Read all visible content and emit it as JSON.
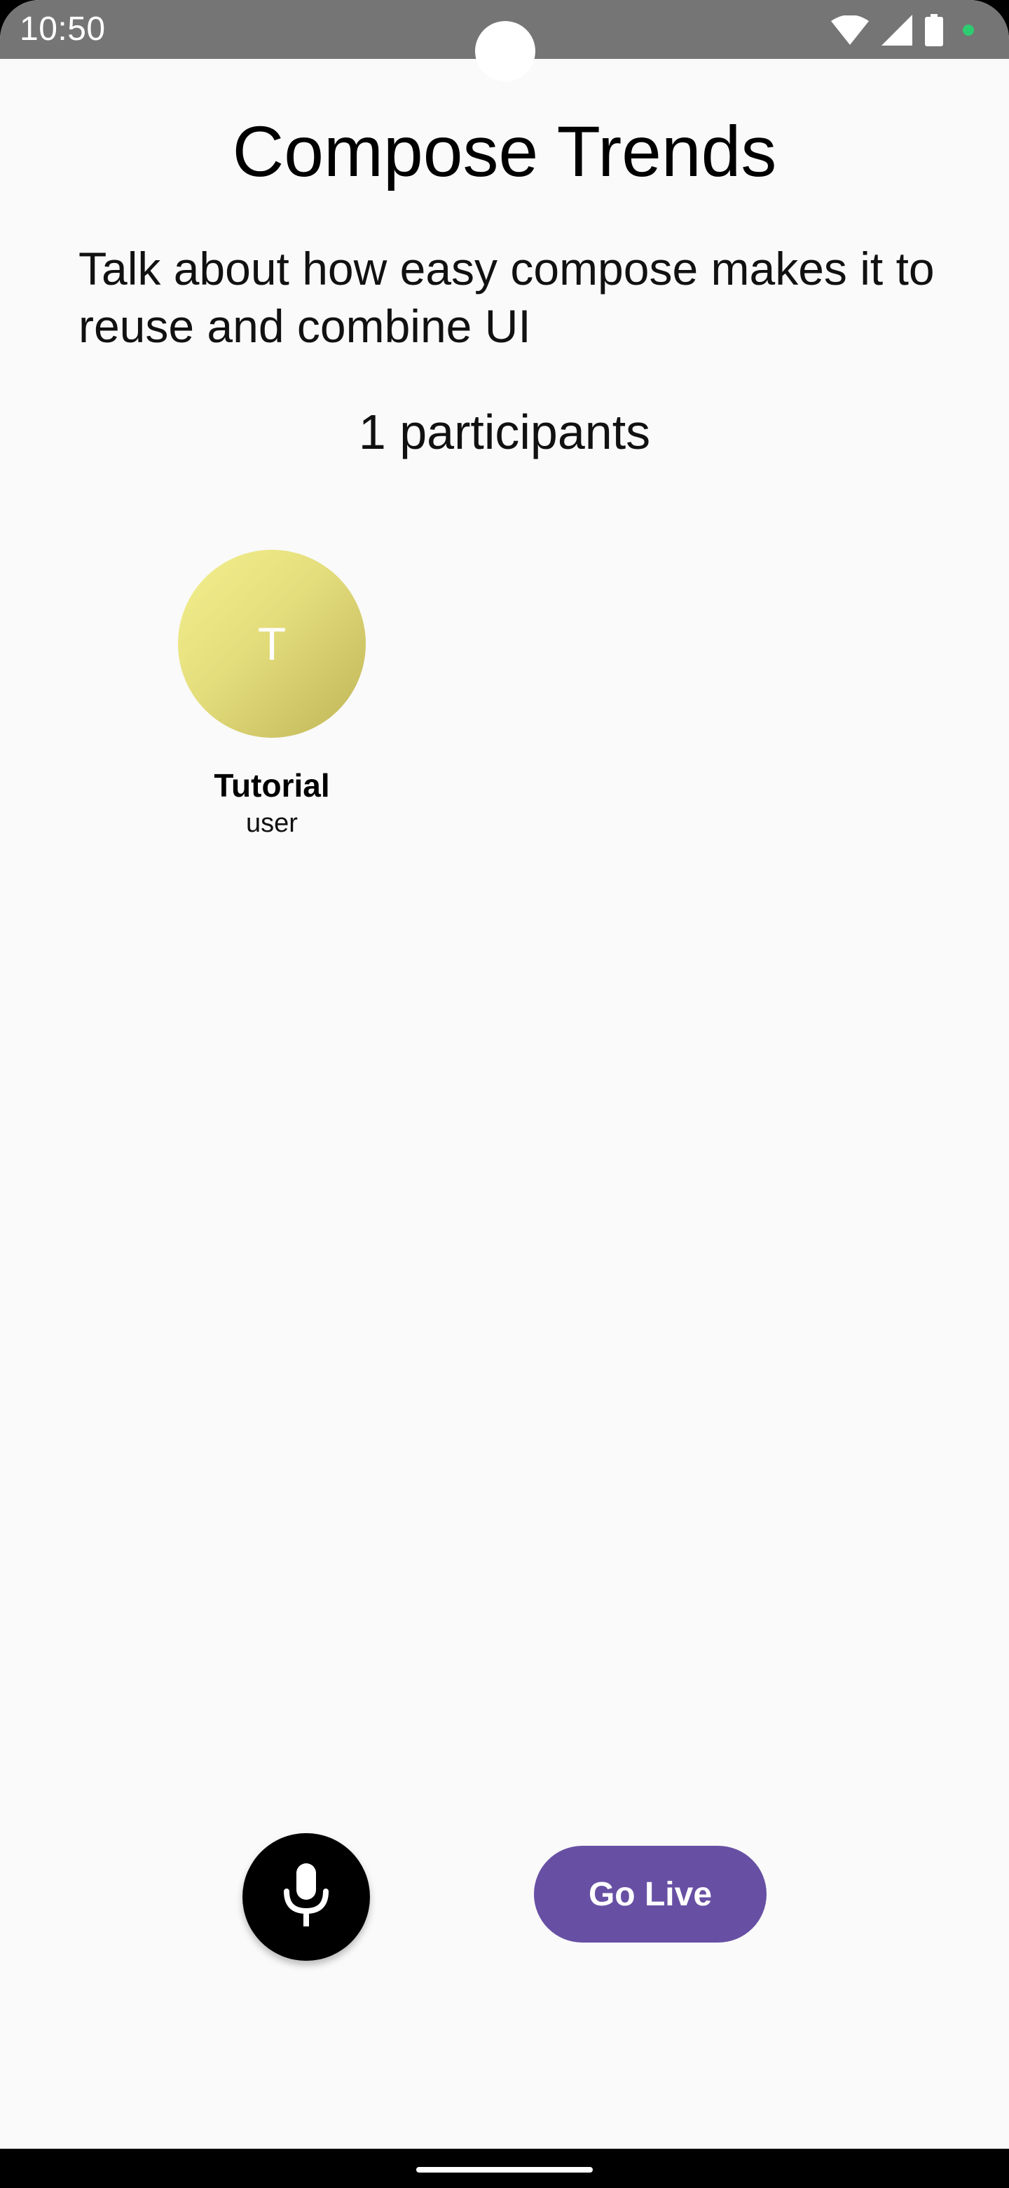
{
  "status_bar": {
    "time": "10:50",
    "icons": [
      "wifi-icon",
      "signal-icon",
      "battery-icon",
      "privacy-indicator-dot"
    ],
    "privacy_dot_color": "#2ecc71"
  },
  "room": {
    "title": "Compose Trends",
    "description": "Talk about how easy compose makes it to reuse and combine UI",
    "participants_count_label": "1 participants"
  },
  "participants": [
    {
      "initial": "T",
      "name": "Tutorial",
      "role": "user",
      "avatar_colors": [
        "#f4f08e",
        "#bfb557"
      ]
    }
  ],
  "controls": {
    "mic_icon": "microphone-icon",
    "go_live_label": "Go Live",
    "go_live_color": "#6750a4"
  }
}
